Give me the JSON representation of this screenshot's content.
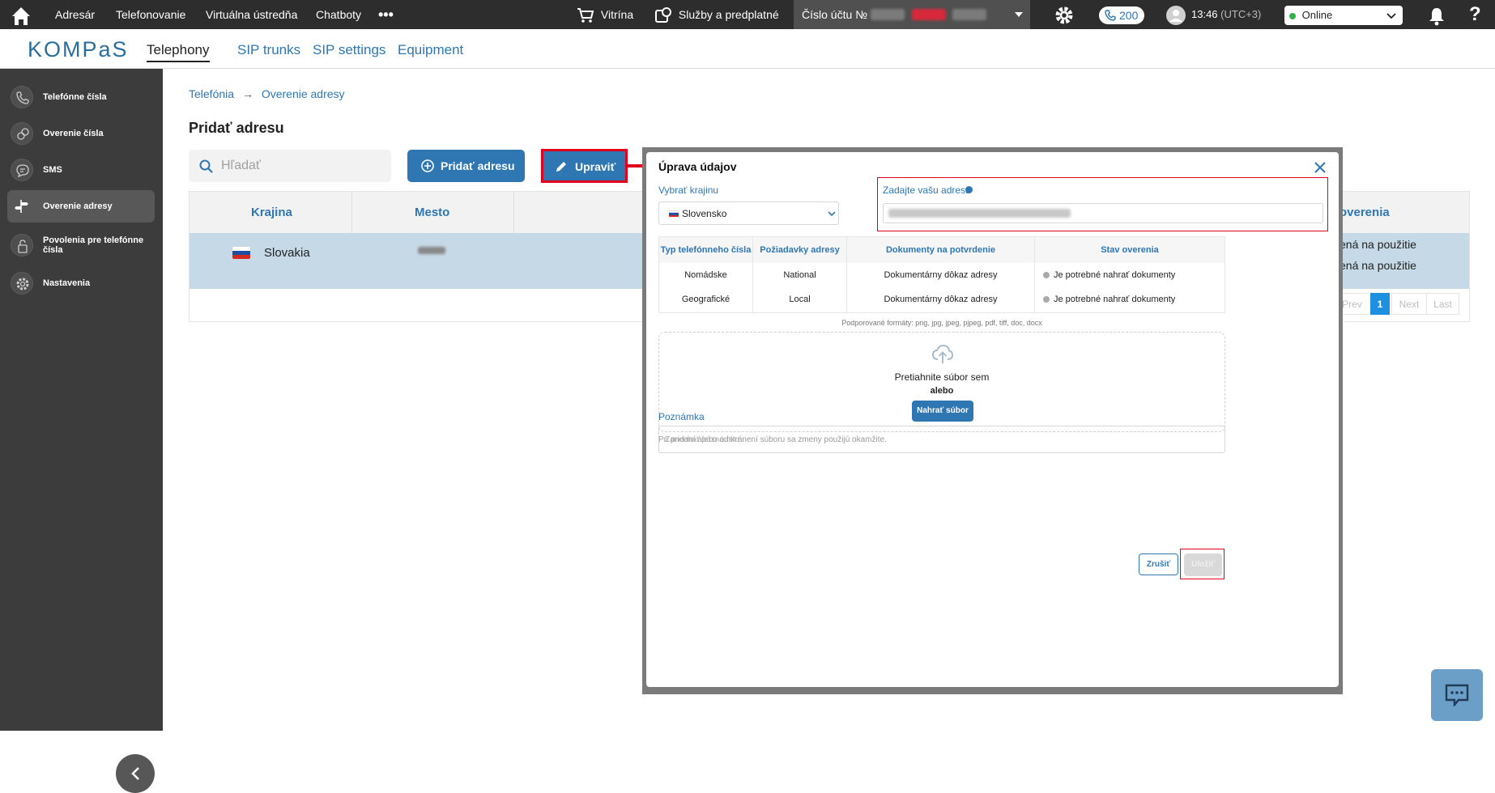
{
  "topnav": {
    "items": [
      "Adresár",
      "Telefonovanie",
      "Virtuálna ústredňa",
      "Chatboty"
    ],
    "more": "•••",
    "store": "Vitrína",
    "services": "Služby a predplatné",
    "account_label": "Číslo účtu №",
    "calls_count": "200",
    "time": "13:46",
    "timezone": "(UTC+3)",
    "status": "Online",
    "help": "?",
    "colors": {
      "bar": "#2d2d2d",
      "accent": "#2e77b3",
      "online": "#2fb34a",
      "highlight": "#e0001b"
    }
  },
  "subnav": {
    "logo": "KOMPaS",
    "tabs": [
      "Telephony",
      "SIP trunks",
      "SIP settings",
      "Equipment"
    ]
  },
  "sidebar": {
    "items": [
      {
        "label": "Telefónne čísla",
        "icon": "phone-icon"
      },
      {
        "label": "Overenie čísla",
        "icon": "verify-number-icon"
      },
      {
        "label": "SMS",
        "icon": "sms-icon"
      },
      {
        "label": "Overenie adresy",
        "icon": "signpost-icon"
      },
      {
        "label": "Povolenia pre telefónne čísla",
        "icon": "lock-icon"
      },
      {
        "label": "Nastavenia",
        "icon": "gear-icon"
      }
    ]
  },
  "main": {
    "breadcrumb": {
      "first": "Telefónia",
      "separator": "→",
      "second": "Overenie adresy"
    },
    "title": "Pridať adresu",
    "search_placeholder": "Hľadať",
    "add_button": "Pridať adresu",
    "edit_button": "Upraviť",
    "table": {
      "headers": [
        "Krajina",
        "Mesto"
      ],
      "right_header": "overenia",
      "row": {
        "country": "Slovakia"
      },
      "status_lines": [
        "ená na použitie",
        "ená na použitie"
      ]
    },
    "pagination": [
      "Prev",
      "1",
      "Next",
      "Last"
    ]
  },
  "modal": {
    "title": "Úprava údajov",
    "country_label": "Vybrať krajinu",
    "country_value": "Slovensko",
    "address_label": "Zadajte vašu adresu",
    "table": {
      "headers": [
        "Typ telefónneho čísla",
        "Požiadavky adresy",
        "Dokumenty na potvrdenie",
        "Stav overenia"
      ],
      "rows": [
        [
          "Nomádske",
          "National",
          "Dokumentárny dôkaz adresy",
          "Je potrebné nahrať dokumenty"
        ],
        [
          "Geografické",
          "Local",
          "Dokumentárny dôkaz adresy",
          "Je potrebné nahrať dokumenty"
        ]
      ]
    },
    "formats": "Podporované formáty: png, jpg, jpeg, pjpeg, pdf, tiff, doc, docx",
    "drop_text": "Pretiahnite súbor sem",
    "or_text": "alebo",
    "upload_button": "Nahrať súbor",
    "hint": "Pri pridaní alebo odstránení súboru sa zmeny použijú okamžite.",
    "note_label": "Poznámka",
    "note_placeholder": "Zanechať poznámku",
    "cancel_button": "Zrušiť",
    "save_button": "Uložiť"
  }
}
